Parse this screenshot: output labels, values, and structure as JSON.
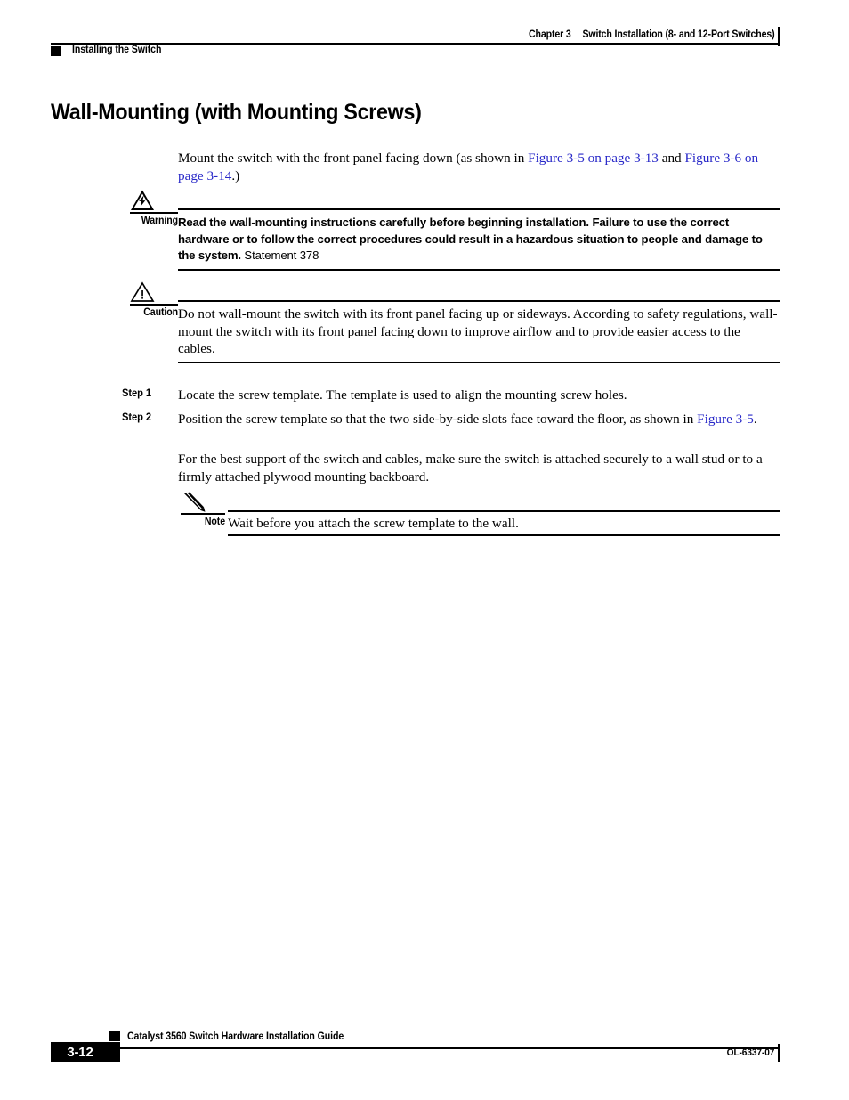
{
  "header": {
    "chapter_number": "Chapter 3",
    "chapter_title": "Switch Installation (8- and 12-Port Switches)",
    "section_title": "Installing the Switch"
  },
  "main": {
    "page_title": "Wall-Mounting (with Mounting Screws)",
    "intro": {
      "text_before": "Mount the switch with the front panel facing down (as shown in ",
      "link1": "Figure 3-5 on page 3-13",
      "text_middle": " and ",
      "link2": "Figure 3-6 on page 3-14",
      "text_after": ".)"
    },
    "warning": {
      "label": "Warning",
      "icon": "warning-lightning-triangle-icon",
      "text": "Read the wall-mounting instructions carefully before beginning installation. Failure to use the correct hardware or to follow the correct procedures could result in a hazardous situation to people and damage to the system.",
      "statement": " Statement 378"
    },
    "caution": {
      "label": "Caution",
      "icon": "caution-exclamation-triangle-icon",
      "text": "Do not wall-mount the switch with its front panel facing up or sideways. According to safety regulations, wall-mount the switch with its front panel facing down to improve airflow and to provide easier access to the cables."
    },
    "steps": [
      {
        "label": "Step 1",
        "text": "Locate the screw template. The template is used to align the mounting screw holes."
      },
      {
        "label": "Step 2",
        "text_before": "Position the screw template so that the two side-by-side slots face toward the floor, as shown in ",
        "link": "Figure 3-5",
        "text_after": "."
      }
    ],
    "step2_followup": "For the best support of the switch and cables, make sure the switch is attached securely to a wall stud or to a firmly attached plywood mounting backboard.",
    "note": {
      "label": "Note",
      "icon": "pencil-icon",
      "text": "Wait before you attach the screw template to the wall."
    }
  },
  "footer": {
    "guide_title": "Catalyst 3560 Switch Hardware Installation Guide",
    "page_number": "3-12",
    "document_id": "OL-6337-07"
  },
  "colors": {
    "link": "#2727c8",
    "text": "#000000",
    "background": "#ffffff"
  }
}
